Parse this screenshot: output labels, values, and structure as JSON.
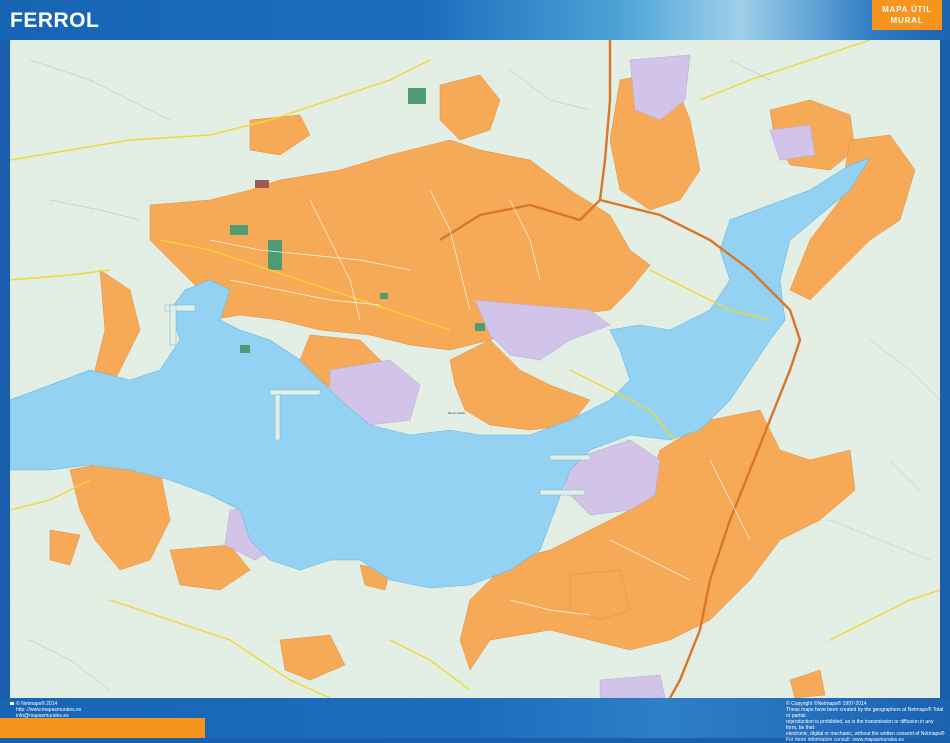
{
  "header": {
    "title": "FERROL",
    "badge_line1": "MAPA ÚTIL",
    "badge_line2": "MURAL"
  },
  "map": {
    "water_label": "Illa Do Santo",
    "colors": {
      "water": "#93d2f2",
      "urban": "#f6aa58",
      "industrial": "#d2c4e8",
      "park": "#4f9c74",
      "rural": "#e3efe4",
      "road": "#f5d632",
      "highway": "#d9762a"
    }
  },
  "footer": {
    "left_lines": [
      "© Netmaps® 2014",
      "http: //www.mapasmurales.es",
      "info@mapasmurales.es"
    ],
    "right_lines": [
      "© Copyright ©Netmaps® 1997-2014",
      "These maps have been created by the geographers at Netmaps® Total or partial",
      "reproduction is prohibited, as is the transmission or diffusion in any form, be that",
      "electronic, digital or mechanic, without the written consent of Netmaps®",
      "For more information consult: www.mapasmurales.es"
    ]
  }
}
